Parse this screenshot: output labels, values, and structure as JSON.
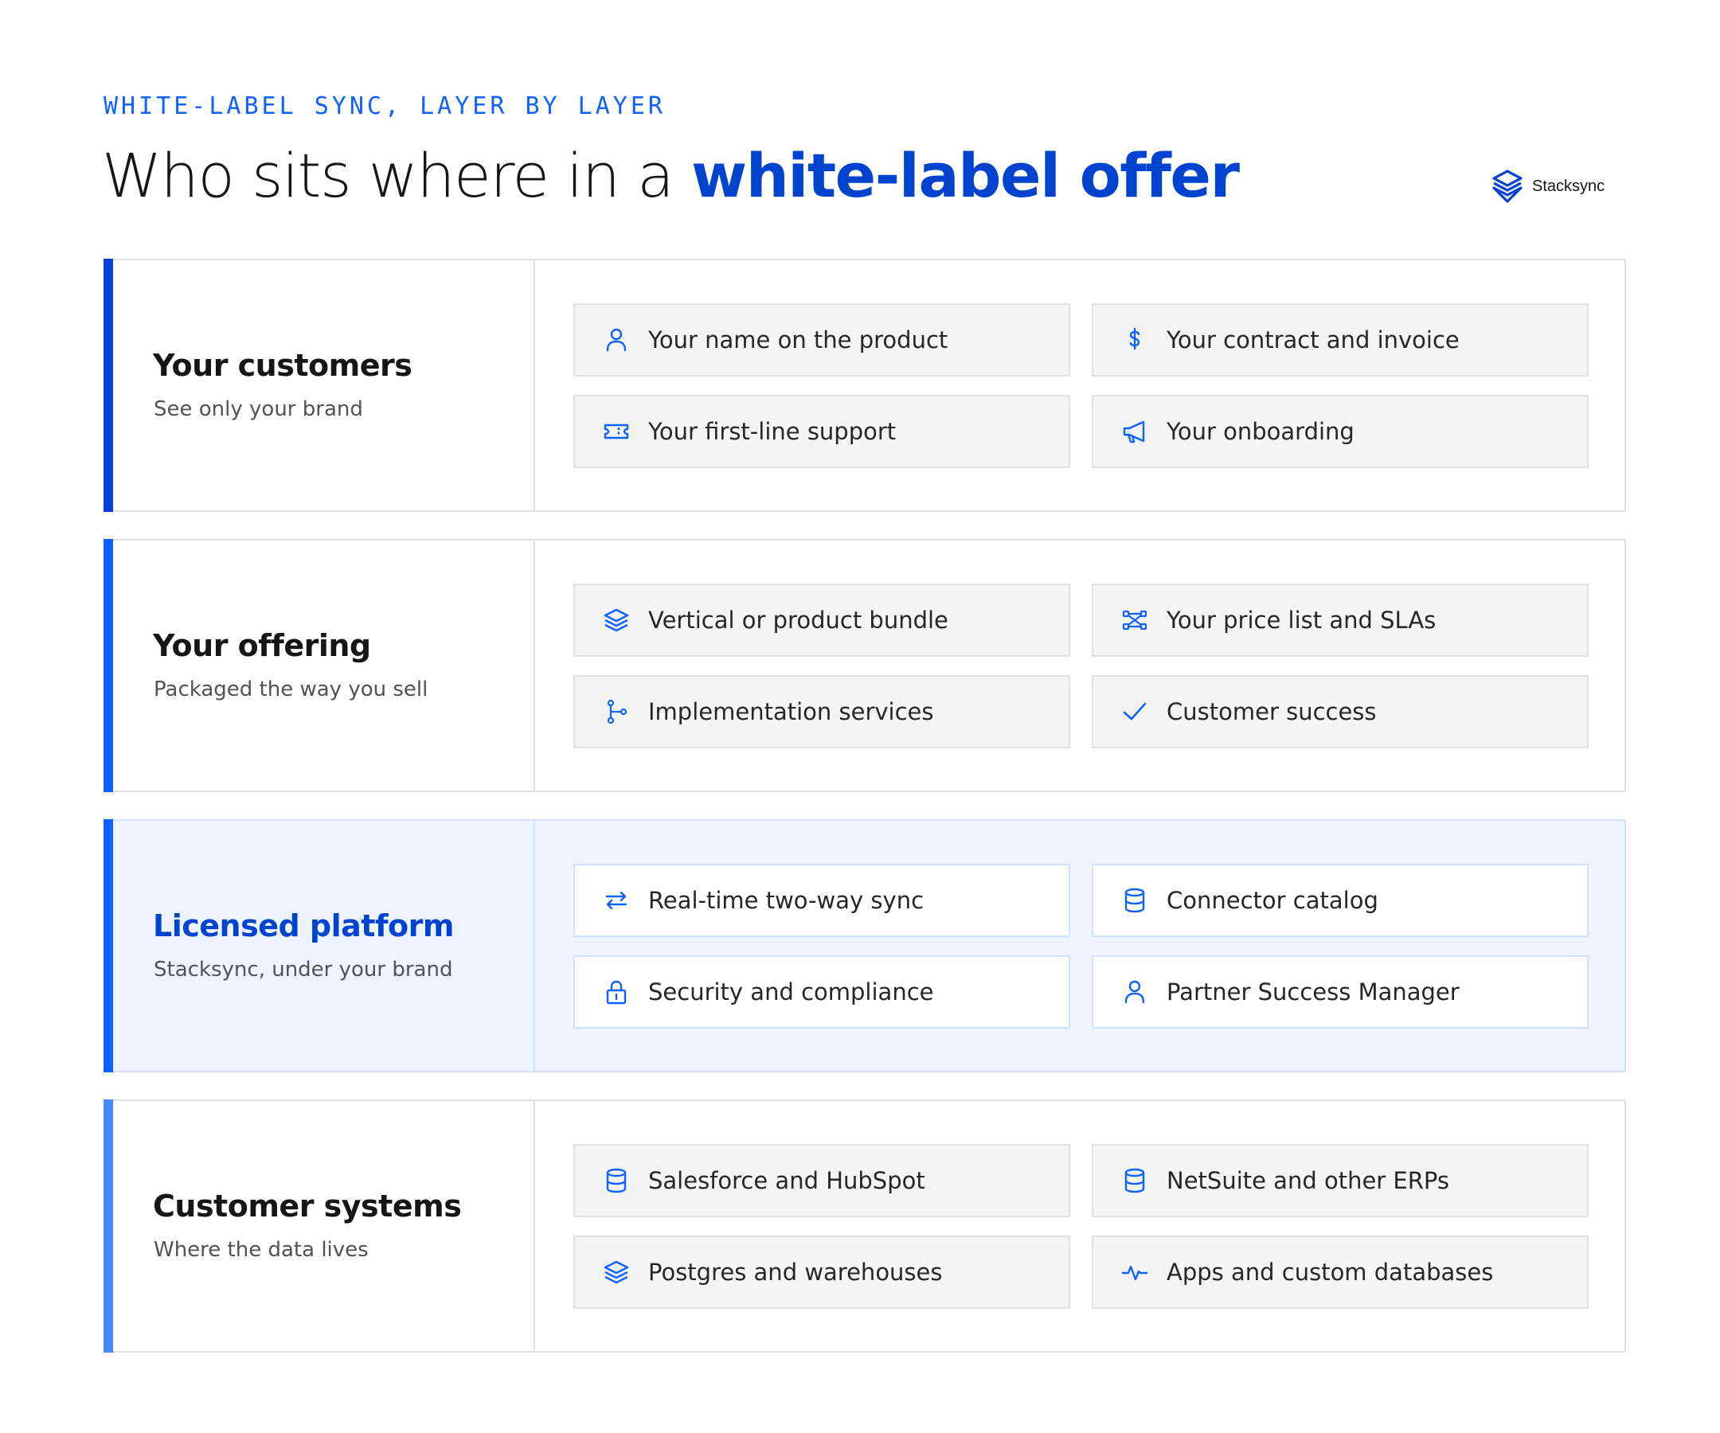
{
  "header": {
    "eyebrow": "WHITE-LABEL SYNC, LAYER BY LAYER",
    "title_plain": "Who sits where in a ",
    "title_accent": "white-label offer",
    "logo_text": "Stacksync"
  },
  "colors": {
    "accent": "#0043ce",
    "bar_customers": "#0043ce",
    "bar_offering": "#0f62fe",
    "bar_platform": "#0f62fe",
    "bar_systems": "#4589ff",
    "highlight_bg": "#edf4ff"
  },
  "layers": [
    {
      "name": "Your customers",
      "subtitle": "See only your brand",
      "items": [
        {
          "label": "Your name on the product",
          "icon": "user-icon"
        },
        {
          "label": "Your contract and invoice",
          "icon": "dollar-icon"
        },
        {
          "label": "Your first-line support",
          "icon": "ticket-icon"
        },
        {
          "label": "Your onboarding",
          "icon": "megaphone-icon"
        }
      ]
    },
    {
      "name": "Your offering",
      "subtitle": "Packaged the way you sell",
      "items": [
        {
          "label": "Vertical or product bundle",
          "icon": "layers-icon"
        },
        {
          "label": "Your price list and SLAs",
          "icon": "network-icon"
        },
        {
          "label": "Implementation services",
          "icon": "branch-icon"
        },
        {
          "label": "Customer success",
          "icon": "checkmark-icon"
        }
      ]
    },
    {
      "name": "Licensed platform",
      "subtitle": "Stacksync, under your brand",
      "items": [
        {
          "label": "Real-time two-way sync",
          "icon": "arrows-exchange-icon"
        },
        {
          "label": "Connector catalog",
          "icon": "database-icon"
        },
        {
          "label": "Security and compliance",
          "icon": "lock-icon"
        },
        {
          "label": "Partner Success Manager",
          "icon": "user-icon"
        }
      ]
    },
    {
      "name": "Customer systems",
      "subtitle": "Where the data lives",
      "items": [
        {
          "label": "Salesforce and HubSpot",
          "icon": "database-icon"
        },
        {
          "label": "NetSuite and other ERPs",
          "icon": "database-icon"
        },
        {
          "label": "Postgres and warehouses",
          "icon": "layers-icon"
        },
        {
          "label": "Apps and custom databases",
          "icon": "activity-icon"
        }
      ]
    }
  ]
}
